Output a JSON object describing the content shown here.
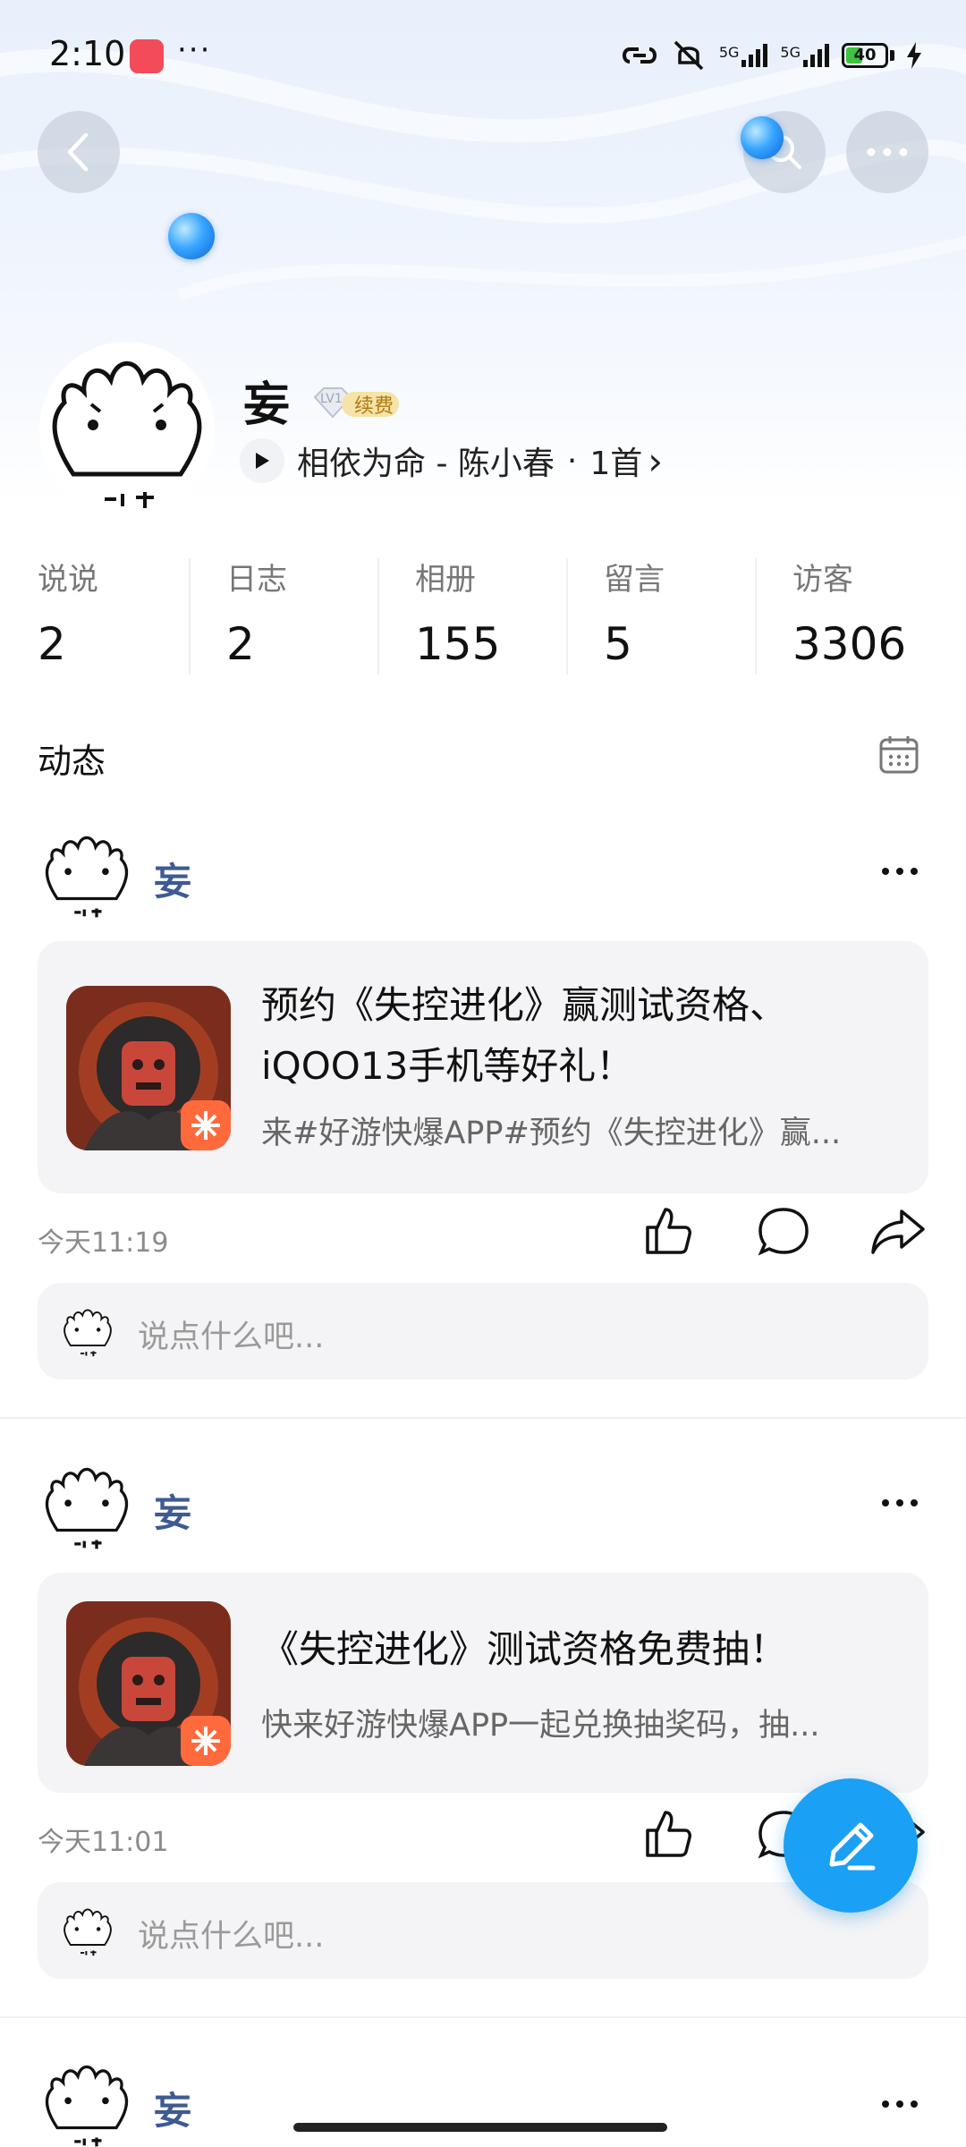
{
  "status_bar": {
    "time": "2:10",
    "more": "···",
    "net1": "5G",
    "net2": "5G",
    "battery": "40"
  },
  "header": {
    "back_icon": "chevron-left-icon",
    "search_icon": "search-icon",
    "more_icon": "more-dots-icon"
  },
  "profile": {
    "nickname": "妄",
    "vip_badge_text": "续费",
    "vip_level": "LV1",
    "music_title": "相依为命 - 陈小春",
    "music_sep": "·",
    "music_count": "1首",
    "music_arrow": "›"
  },
  "stats": [
    {
      "label": "说说",
      "value": "2"
    },
    {
      "label": "日志",
      "value": "2"
    },
    {
      "label": "相册",
      "value": "155"
    },
    {
      "label": "留言",
      "value": "5"
    },
    {
      "label": "访客",
      "value": "3306"
    }
  ],
  "feed": {
    "title": "动态",
    "calendar_icon": "calendar-icon",
    "posts": [
      {
        "author": "妄",
        "more": "···",
        "card_title": "预约《失控进化》赢测试资格、iQOO13手机等好礼！",
        "card_sub": "来#好游快爆APP#预约《失控进化》赢...",
        "time": "今天11:19",
        "comment_placeholder": "说点什么吧..."
      },
      {
        "author": "妄",
        "more": "···",
        "card_title": "《失控进化》测试资格免费抽！",
        "card_sub": "快来好游快爆APP一起兑换抽奖码，抽...",
        "time": "今天11:01",
        "comment_placeholder": "说点什么吧..."
      },
      {
        "author": "妄",
        "more": "···"
      }
    ]
  },
  "fab": {
    "icon": "pencil-edit-icon"
  },
  "colors": {
    "accent": "#1aa0f5",
    "author_name": "#3d5a93"
  }
}
